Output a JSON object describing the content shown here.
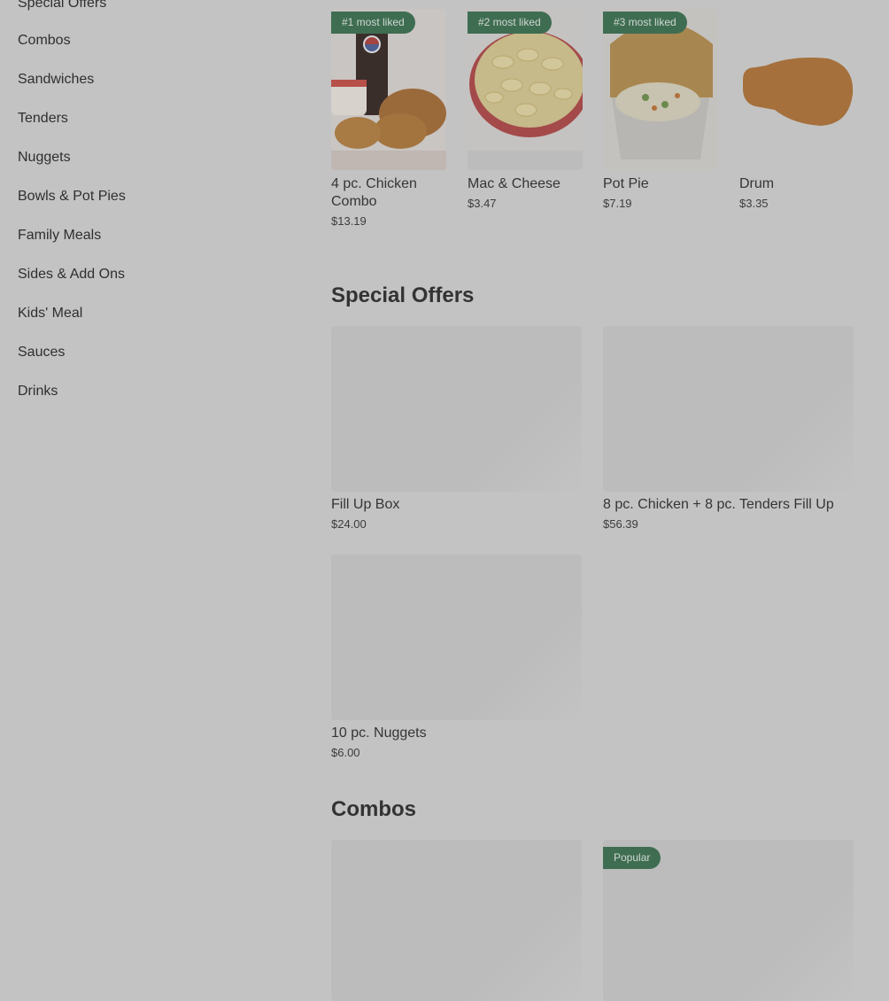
{
  "sidebar": {
    "items": [
      {
        "label": "Special Offers"
      },
      {
        "label": "Combos"
      },
      {
        "label": "Sandwiches"
      },
      {
        "label": "Tenders"
      },
      {
        "label": "Nuggets"
      },
      {
        "label": "Bowls & Pot Pies"
      },
      {
        "label": "Family Meals"
      },
      {
        "label": "Sides & Add Ons"
      },
      {
        "label": "Kids' Meal"
      },
      {
        "label": "Sauces"
      },
      {
        "label": "Drinks"
      }
    ]
  },
  "most_liked": [
    {
      "badge": "#1 most liked",
      "name_line1": "4 pc. Chicken",
      "name_line2": "Combo",
      "price": "$13.19"
    },
    {
      "badge": "#2 most liked",
      "name": "Mac & Cheese",
      "price": "$3.47"
    },
    {
      "badge": "#3 most liked",
      "name": "Pot Pie",
      "price": "$7.19"
    },
    {
      "name": "Drum",
      "price": "$3.35"
    }
  ],
  "special_offers": {
    "title": "Special Offers",
    "items": [
      {
        "name": "Fill Up Box",
        "price": "$24.00"
      },
      {
        "name": "8 pc. Chicken + 8 pc. Tenders Fill Up",
        "price": "$56.39"
      },
      {
        "name": "10 pc. Nuggets",
        "price": "$6.00"
      }
    ]
  },
  "combos": {
    "title": "Combos",
    "items": [
      {},
      {
        "badge": "Popular"
      }
    ]
  },
  "colors": {
    "overlay_bg": "#c3c3c3",
    "badge_bg": "#3f6d52"
  }
}
